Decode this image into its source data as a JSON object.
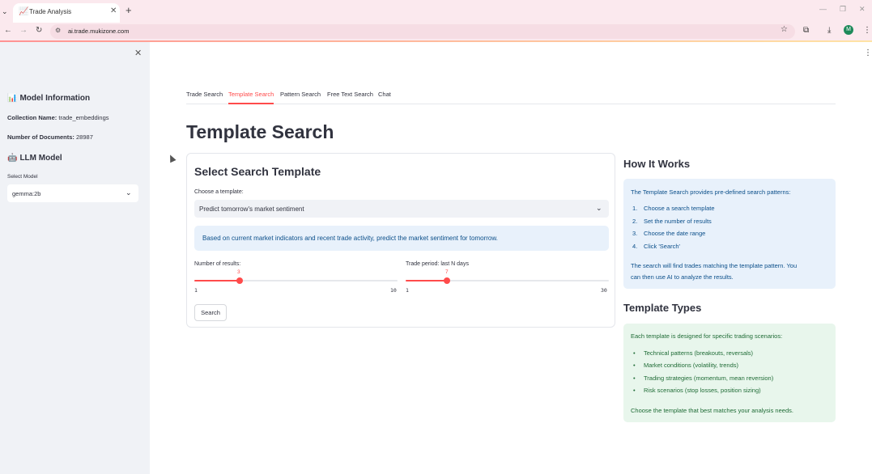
{
  "browser": {
    "tab_title": "Trade Analysis",
    "url": "ai.trade.mukizone.com",
    "profile_initial": "M"
  },
  "sidebar": {
    "model_info_heading": "Model Information",
    "collection_label": "Collection Name:",
    "collection_value": "trade_embeddings",
    "docs_label": "Number of Documents:",
    "docs_value": "28987",
    "llm_heading": "LLM Model",
    "select_model_label": "Select Model",
    "select_model_value": "gemma:2b"
  },
  "tabs": [
    {
      "label": "Trade Search",
      "active": false
    },
    {
      "label": "Template Search",
      "active": true
    },
    {
      "label": "Pattern Search",
      "active": false
    },
    {
      "label": "Free Text Search",
      "active": false
    },
    {
      "label": "Chat",
      "active": false
    }
  ],
  "main": {
    "page_title": "Template Search",
    "card_heading": "Select Search Template",
    "template_label": "Choose a template:",
    "template_value": "Predict tomorrow's market sentiment",
    "template_description": "Based on current market indicators and recent trade activity, predict the market sentiment for tomorrow.",
    "results_slider": {
      "label": "Number of results:",
      "value": "3",
      "min": "1",
      "max": "10"
    },
    "period_slider": {
      "label": "Trade period: last N days",
      "value": "7",
      "min": "1",
      "max": "30"
    },
    "search_button": "Search"
  },
  "how_it_works": {
    "heading": "How It Works",
    "intro": "The Template Search provides pre-defined search patterns:",
    "steps": [
      "Choose a search template",
      "Set the number of results",
      "Choose the date range",
      "Click 'Search'"
    ],
    "outro_1": "The search will find trades matching the template pattern. You",
    "outro_2": "can then use AI to analyze the results."
  },
  "template_types": {
    "heading": "Template Types",
    "intro": "Each template is designed for specific trading scenarios:",
    "items": [
      "Technical patterns (breakouts, reversals)",
      "Market conditions (volatility, trends)",
      "Trading strategies (momentum, mean reversion)",
      "Risk scenarios (stop losses, position sizing)"
    ],
    "outro": "Choose the template that best matches your analysis needs."
  },
  "colors": {
    "accent": "#ff4b4b",
    "sidebar_bg": "#f0f2f6",
    "info_blue": "#e8f1fb",
    "success_green": "#e8f6ec"
  }
}
